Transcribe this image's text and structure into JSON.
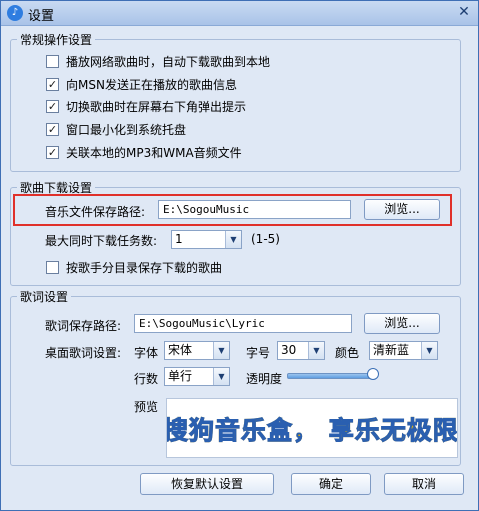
{
  "window": {
    "title": "设置",
    "app_icon": "music-app-icon",
    "close_label": "✕"
  },
  "general": {
    "legend": "常规操作设置",
    "items": [
      {
        "label": "播放网络歌曲时，自动下载歌曲到本地",
        "checked": false
      },
      {
        "label": "向MSN发送正在播放的歌曲信息",
        "checked": true
      },
      {
        "label": "切换歌曲时在屏幕右下角弹出提示",
        "checked": true
      },
      {
        "label": "窗口最小化到系统托盘",
        "checked": true
      },
      {
        "label": "关联本地的MP3和WMA音频文件",
        "checked": true
      }
    ]
  },
  "download": {
    "legend": "歌曲下载设置",
    "path_label": "音乐文件保存路径:",
    "path_value": "E:\\SogouMusic",
    "browse_label": "浏览...",
    "max_tasks_label": "最大同时下载任务数:",
    "max_tasks_value": "1",
    "max_tasks_range": "(1-5)",
    "by_singer_label": "按歌手分目录保存下载的歌曲",
    "by_singer_checked": false
  },
  "lyrics": {
    "legend": "歌词设置",
    "path_label": "歌词保存路径:",
    "path_value": "E:\\SogouMusic\\Lyric",
    "browse_label": "浏览...",
    "desktop_label": "桌面歌词设置:",
    "font_label": "字体",
    "font_value": "宋体",
    "size_label": "字号",
    "size_value": "30",
    "color_label": "颜色",
    "color_value": "清新蓝",
    "lines_label": "行数",
    "lines_value": "单行",
    "opacity_label": "透明度",
    "opacity_value": 1.0,
    "preview_label": "预览",
    "preview_text": "搜狗音乐盒， 享乐无极限"
  },
  "footer": {
    "restore_label": "恢复默认设置",
    "ok_label": "确定",
    "cancel_label": "取消"
  },
  "colors": {
    "highlight": "#e0302a",
    "window_bg": "#dfe8f5",
    "title_bg": "#a9c3e8"
  }
}
